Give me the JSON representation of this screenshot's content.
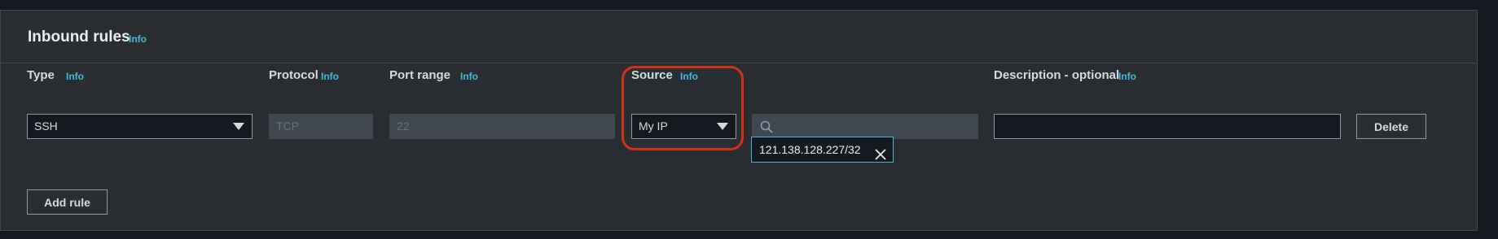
{
  "panel": {
    "title": "Inbound rules",
    "info": "Info"
  },
  "columns": {
    "type": {
      "label": "Type",
      "info": "Info"
    },
    "protocol": {
      "label": "Protocol",
      "info": "Info"
    },
    "port_range": {
      "label": "Port range",
      "info": "Info"
    },
    "source": {
      "label": "Source",
      "info": "Info"
    },
    "description": {
      "label": "Description - optional",
      "info": "Info"
    }
  },
  "rule": {
    "type_value": "SSH",
    "protocol_value": "TCP",
    "port_range_value": "22",
    "source_value": "My IP",
    "source_search_value": "",
    "source_token": "121.138.128.227/32",
    "description_value": "",
    "delete_label": "Delete"
  },
  "actions": {
    "add_rule_label": "Add rule"
  },
  "icons": {
    "type_caret": "caret-down-icon",
    "source_caret": "caret-down-icon",
    "search": "search-icon",
    "token_remove": "close-icon"
  },
  "colors": {
    "background": "#16191f",
    "panel": "#2a2e33",
    "info_link": "#44b9d6",
    "highlight": "#d13212"
  }
}
